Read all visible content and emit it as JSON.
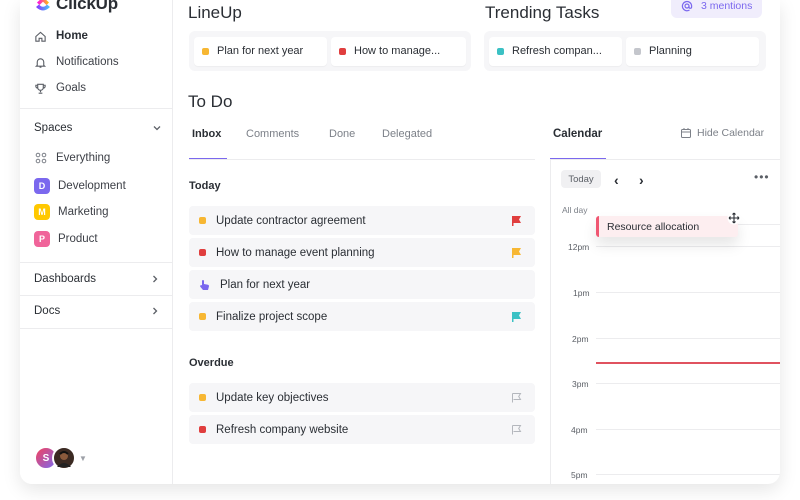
{
  "app": {
    "logo_text": "ClickUp"
  },
  "sidebar": {
    "nav": [
      {
        "label": "Home",
        "icon": "home-icon"
      },
      {
        "label": "Notifications",
        "icon": "bell-icon"
      },
      {
        "label": "Goals",
        "icon": "trophy-icon"
      }
    ],
    "spaces_label": "Spaces",
    "spaces": [
      {
        "label": "Everything",
        "icon": "grid-icon"
      },
      {
        "label": "Development",
        "badge": "D",
        "color": "#7b68ee"
      },
      {
        "label": "Marketing",
        "badge": "M",
        "color": "#ffc800"
      },
      {
        "label": "Product",
        "badge": "P",
        "color": "#f0649a"
      }
    ],
    "dashboards_label": "Dashboards",
    "docs_label": "Docs",
    "avatar_initial": "S"
  },
  "lineup": {
    "title": "LineUp",
    "items": [
      {
        "label": "Plan for next year",
        "color": "#f7b733"
      },
      {
        "label": "How to manage...",
        "color": "#e03e3e"
      }
    ]
  },
  "trending": {
    "title": "Trending Tasks",
    "items": [
      {
        "label": "Refresh compan...",
        "color": "#3bc1c4"
      },
      {
        "label": "Planning",
        "color": "#c4c6cc"
      }
    ]
  },
  "mentions": {
    "label": "3 mentions"
  },
  "todo": {
    "title": "To Do",
    "tabs": [
      "Inbox",
      "Comments",
      "Done",
      "Delegated"
    ],
    "today_label": "Today",
    "today_tasks": [
      {
        "label": "Update contractor agreement",
        "dot": "#f7b733",
        "flag": "red-flag-icon"
      },
      {
        "label": "How to manage event planning",
        "dot": "#e03e3e",
        "flag": "yellow-flag-icon"
      },
      {
        "label": "Plan for next year",
        "dot": "#7b68ee",
        "flag": ""
      },
      {
        "label": "Finalize project scope",
        "dot": "#f7b733",
        "flag": "cyan-flag-icon"
      }
    ],
    "overdue_label": "Overdue",
    "overdue_tasks": [
      {
        "label": "Update key objectives",
        "dot": "#f7b733",
        "flag": "gray-flag-icon"
      },
      {
        "label": "Refresh company website",
        "dot": "#e03e3e",
        "flag": "gray-flag-icon"
      }
    ]
  },
  "calendar": {
    "title": "Calendar",
    "hide_label": "Hide Calendar",
    "today_button": "Today",
    "all_day_label": "All day",
    "times": [
      "12pm",
      "1pm",
      "2pm",
      "3pm",
      "4pm",
      "5pm"
    ],
    "event": {
      "label": "Resource allocation",
      "color": "#f05772"
    }
  },
  "colors": {
    "accent": "#7b68ee",
    "now_line": "#e0525f"
  }
}
